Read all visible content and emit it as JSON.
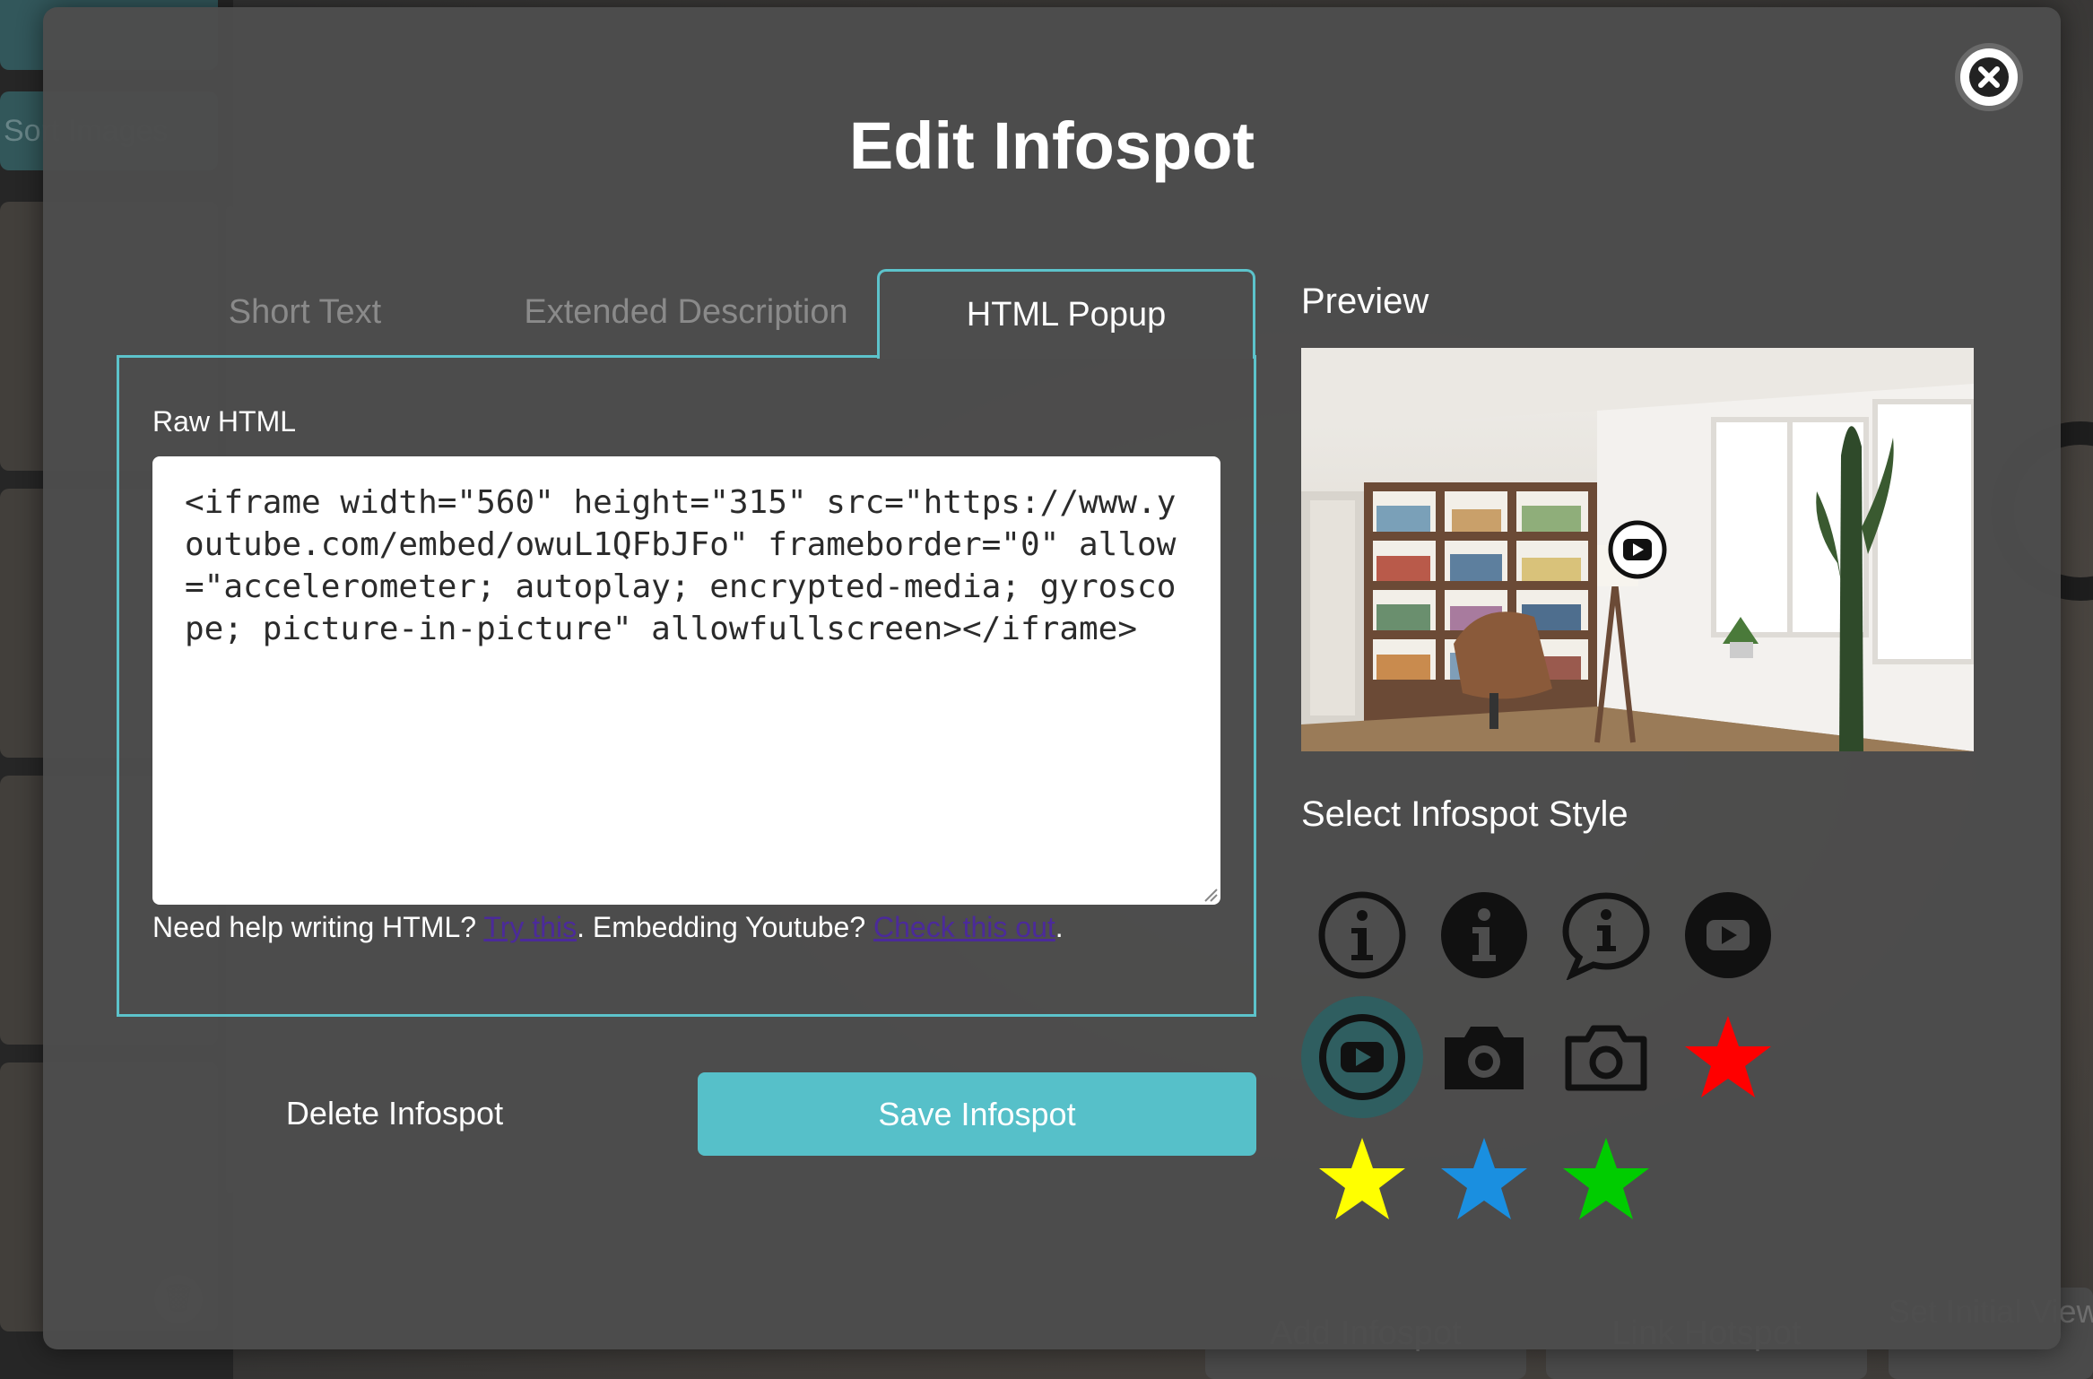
{
  "background": {
    "sidebar_buttons": [
      "",
      "Sort Images"
    ],
    "bottom_buttons": [
      "Add Infospot",
      "Link Hotspot",
      "Set Initial View"
    ]
  },
  "modal": {
    "title": "Edit Infospot",
    "close_icon": "close-icon",
    "tabs": [
      {
        "label": "Short Text",
        "active": false
      },
      {
        "label": "Extended Description",
        "active": false
      },
      {
        "label": "HTML Popup",
        "active": true
      }
    ],
    "raw_html_label": "Raw HTML",
    "raw_html_value": "<iframe width=\"560\" height=\"315\" src=\"https://www.youtube.com/embed/owuL1QFbJFo\" frameborder=\"0\" allow=\"accelerometer; autoplay; encrypted-media; gyroscope; picture-in-picture\" allowfullscreen></iframe>",
    "help": {
      "prefix": "Need help writing HTML? ",
      "link1": "Try this",
      "middle": ". Embedding Youtube? ",
      "link2": "Check this out",
      "suffix": "."
    },
    "delete_label": "Delete Infospot",
    "save_label": "Save Infospot",
    "preview_label": "Preview",
    "style_label": "Select Infospot Style",
    "styles": [
      {
        "icon": "info-outline-icon",
        "selected": false
      },
      {
        "icon": "info-filled-icon",
        "selected": false
      },
      {
        "icon": "info-speech-bubble-icon",
        "selected": false
      },
      {
        "icon": "youtube-filled-icon",
        "selected": false
      },
      {
        "icon": "youtube-outline-icon",
        "selected": true
      },
      {
        "icon": "camera-filled-icon",
        "selected": false
      },
      {
        "icon": "camera-outline-icon",
        "selected": false
      },
      {
        "icon": "star-red-icon",
        "color": "#ff0000",
        "selected": false
      },
      {
        "icon": "star-yellow-icon",
        "color": "#ffff00",
        "selected": false
      },
      {
        "icon": "star-blue-icon",
        "color": "#1a8fe0",
        "selected": false
      },
      {
        "icon": "star-green-icon",
        "color": "#00cc00",
        "selected": false
      }
    ],
    "colors": {
      "accent": "#5cc3cb",
      "save_button": "#56c0c9",
      "modal_bg": "#4d4d4d"
    }
  }
}
